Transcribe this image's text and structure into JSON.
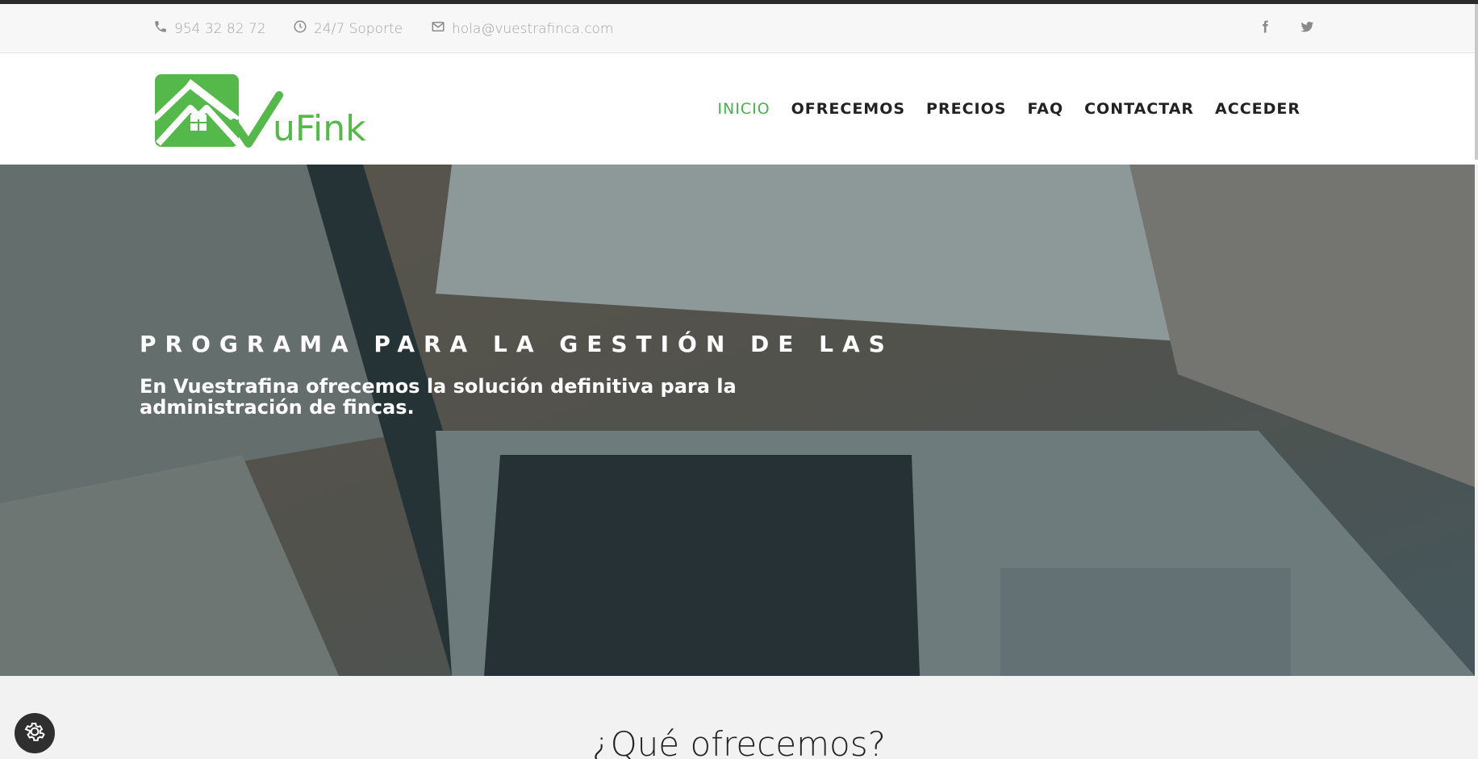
{
  "topbar": {
    "phone": "954 32 82 72",
    "support": "24/7 Soporte",
    "email": "hola@vuestrafinca.com",
    "icons": [
      "phone-icon",
      "clock-icon",
      "mail-icon",
      "facebook-icon",
      "twitter-icon"
    ]
  },
  "header": {
    "logo_text": "uFink",
    "nav": [
      {
        "label": "INICIO",
        "active": true
      },
      {
        "label": "OFRECEMOS",
        "active": false
      },
      {
        "label": "PRECIOS",
        "active": false
      },
      {
        "label": "FAQ",
        "active": false
      },
      {
        "label": "CONTACTAR",
        "active": false
      },
      {
        "label": "ACCEDER",
        "active": false
      }
    ]
  },
  "hero": {
    "heading": "PROGRAMA PARA LA GESTIÓN DE LAS",
    "text": "En Vuestrafina ofrecemos la solución definitiva para la administración de fincas."
  },
  "section": {
    "title": "¿Qué ofrecemos?"
  },
  "colors": {
    "accent": "#4caf50",
    "nav_text": "#222222",
    "topbar_text": "#a3a3a3",
    "logo_green": "#55b84a"
  }
}
